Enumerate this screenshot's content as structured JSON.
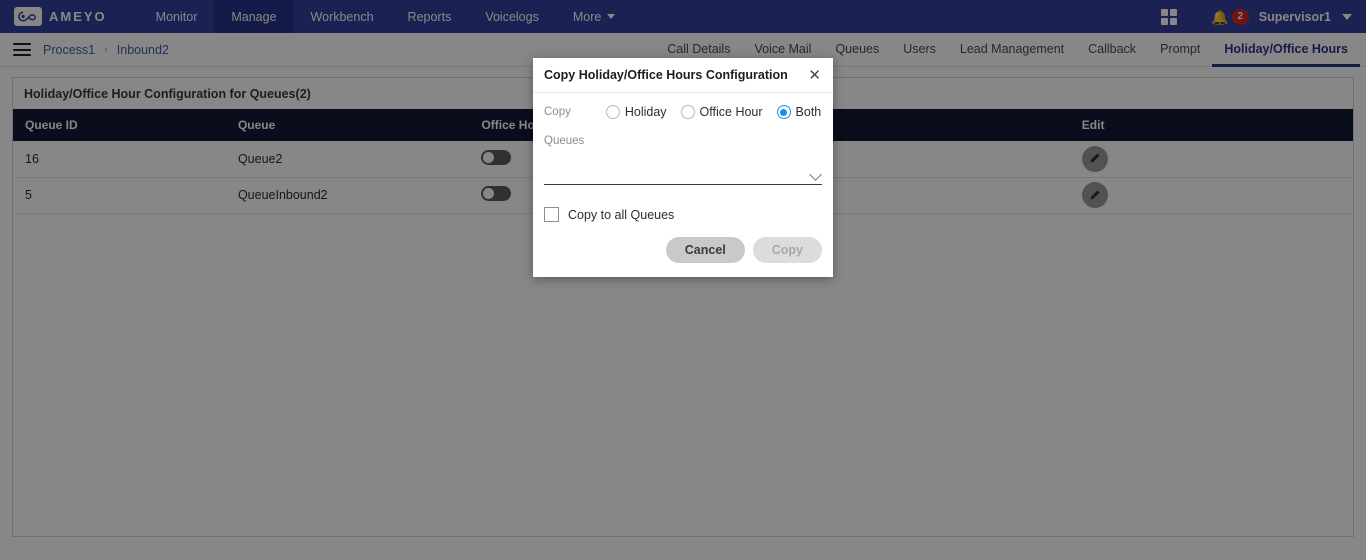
{
  "header": {
    "logo_text": "AMEYO",
    "logo_icon": "ameyo-infinity-logo-icon",
    "nav_items": [
      {
        "label": "Monitor",
        "active": false
      },
      {
        "label": "Manage",
        "active": true
      },
      {
        "label": "Workbench",
        "active": false
      },
      {
        "label": "Reports",
        "active": false
      },
      {
        "label": "Voicelogs",
        "active": false
      },
      {
        "label": "More",
        "active": false
      }
    ],
    "grid_icon": "apps-grid-icon",
    "bell_icon": "bell-icon",
    "notification_count": "2",
    "user_name": "Supervisor1",
    "user_chevron_icon": "chevron-down-icon"
  },
  "subnav": {
    "menu_icon": "hamburger-menu-icon",
    "breadcrumb": [
      {
        "label": "Process1"
      },
      {
        "label": "Inbound2"
      }
    ],
    "breadcrumb_separator": "›",
    "tabs": [
      {
        "label": "Call Details",
        "active": false
      },
      {
        "label": "Voice Mail",
        "active": false
      },
      {
        "label": "Queues",
        "active": false
      },
      {
        "label": "Users",
        "active": false
      },
      {
        "label": "Lead Management",
        "active": false
      },
      {
        "label": "Callback",
        "active": false
      },
      {
        "label": "Prompt",
        "active": false
      },
      {
        "label": "Holiday/Office Hours",
        "active": true
      }
    ]
  },
  "panel": {
    "title": "Holiday/Office Hour Configuration for Queues(2)",
    "columns": [
      "Queue ID",
      "Queue",
      "Office Hour",
      "",
      "Edit"
    ],
    "rows": [
      {
        "queue_id": "16",
        "queue": "Queue2",
        "office_hour_on": false,
        "edit_icon": "pencil-icon"
      },
      {
        "queue_id": "5",
        "queue": "QueueInbound2",
        "office_hour_on": false,
        "edit_icon": "pencil-icon"
      }
    ]
  },
  "modal": {
    "title": "Copy Holiday/Office Hours Configuration",
    "close_icon": "close-icon",
    "copy_label": "Copy",
    "radio_options": [
      {
        "label": "Holiday",
        "selected": false
      },
      {
        "label": "Office Hour",
        "selected": false
      },
      {
        "label": "Both",
        "selected": true
      }
    ],
    "queues_label": "Queues",
    "queues_value": "",
    "queues_chevron_icon": "chevron-down-icon",
    "copy_all_label": "Copy to all Queues",
    "copy_all_checked": false,
    "cancel_label": "Cancel",
    "copy_label_button": "Copy",
    "copy_button_disabled": true
  },
  "colors": {
    "header_blue": "#33409e",
    "header_active_blue": "#28348a",
    "table_header_navy": "#131a33",
    "accent_blue": "#1a8fe3",
    "badge_red": "#d8262c",
    "link_blue": "#3f5fa8"
  }
}
